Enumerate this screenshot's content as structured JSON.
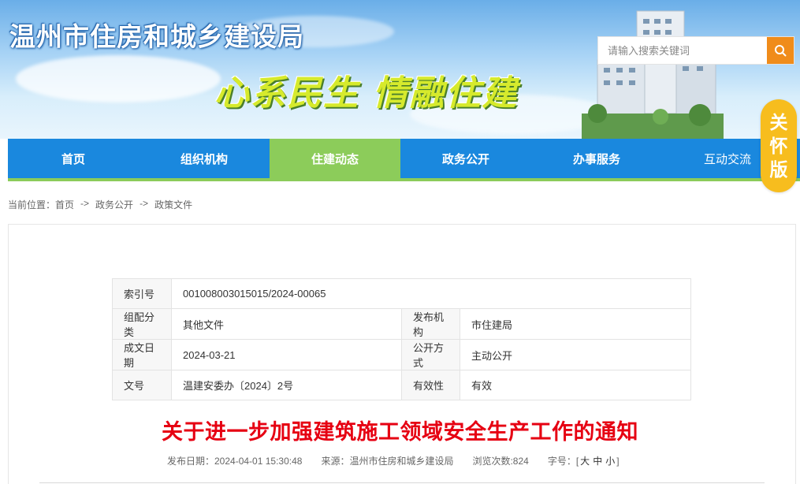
{
  "header": {
    "site_title": "温州市住房和城乡建设局",
    "slogan": "心系民生  情融住建",
    "search_placeholder": "请输入搜索关键词",
    "care_mode": [
      "关",
      "怀",
      "版"
    ]
  },
  "nav": {
    "items": [
      {
        "label": "首页",
        "active": false
      },
      {
        "label": "组织机构",
        "active": false
      },
      {
        "label": "住建动态",
        "active": true
      },
      {
        "label": "政务公开",
        "active": false
      },
      {
        "label": "办事服务",
        "active": false
      },
      {
        "label": "互动交流",
        "active": false
      }
    ]
  },
  "breadcrumb": {
    "prefix": "当前位置：",
    "items": [
      "首页",
      "政务公开",
      "政策文件"
    ],
    "separator": "->"
  },
  "info": {
    "index_label": "索引号",
    "index_value": "001008003015015/2024-00065",
    "category_label": "组配分类",
    "category_value": "其他文件",
    "publisher_label": "发布机构",
    "publisher_value": "市住建局",
    "date_label": "成文日期",
    "date_value": "2024-03-21",
    "openness_label": "公开方式",
    "openness_value": "主动公开",
    "docno_label": "文号",
    "docno_value": "温建安委办〔2024〕2号",
    "validity_label": "有效性",
    "validity_value": "有效"
  },
  "article": {
    "title": "关于进一步加强建筑施工领域安全生产工作的通知",
    "publish_date": "发布日期：2024-04-01 15:30:48",
    "source": "来源：温州市住房和城乡建设局",
    "views": "浏览次数:824",
    "fontsize_label": "字号：",
    "fontsize_open": "[",
    "fontsize_large": "大",
    "fontsize_medium": "中",
    "fontsize_small": "小",
    "fontsize_close": "]"
  },
  "colors": {
    "nav_bg": "#1a88de",
    "nav_active": "#8ccc5a",
    "search_btn": "#f08c1a",
    "care_badge": "#f7bd1e",
    "title_red": "#e60012"
  }
}
